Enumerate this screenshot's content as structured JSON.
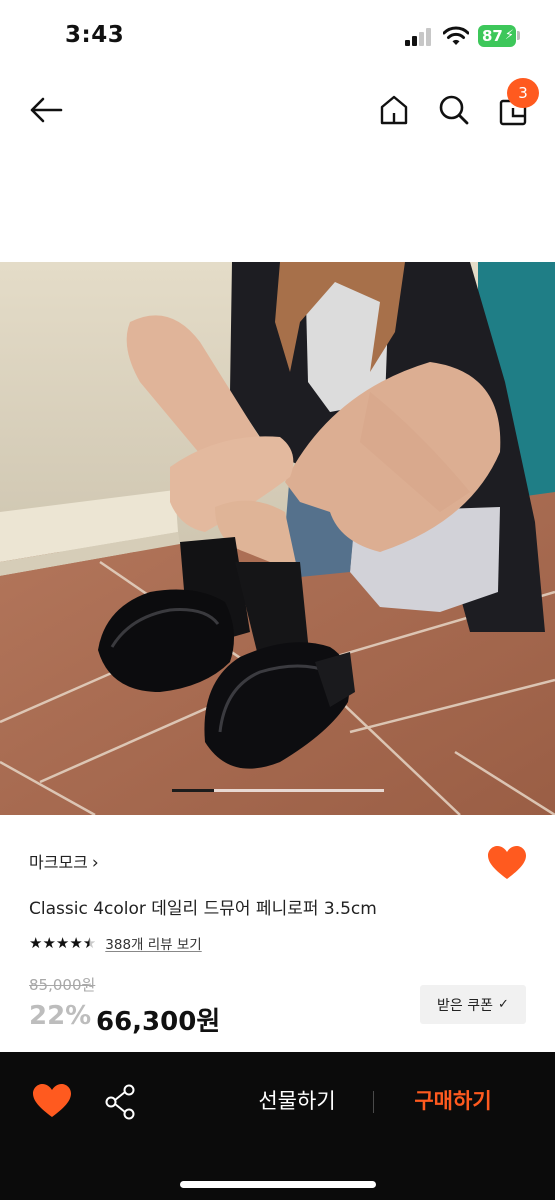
{
  "status_bar": {
    "time": "3:43",
    "battery": "87"
  },
  "nav": {
    "icons": [
      "arrow-left-icon",
      "home-icon",
      "search-icon",
      "shopping-bag-icon"
    ],
    "cart_count": "3"
  },
  "carousel": {
    "current_fraction": 0.2
  },
  "product": {
    "brand": "마크모크",
    "title": "Classic 4color 데일리 드뮤어 페니로퍼 3.5cm",
    "rating": 4.5,
    "review_text": "388개 리뷰 보기",
    "original_price": "85,000원",
    "discount": "22%",
    "sale_price": "66,300원",
    "coupon_label": "받은 쿠폰"
  },
  "bottom_bar": {
    "gift_label": "선물하기",
    "buy_label": "구매하기"
  },
  "colors": {
    "accent": "#ff5a1f",
    "bottom_bar_bg": "#0b0b0b",
    "battery_green": "#3dc75a"
  }
}
